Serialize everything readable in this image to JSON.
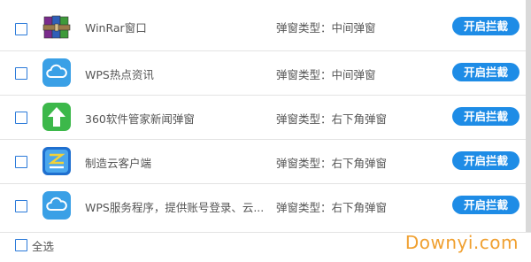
{
  "items": [
    {
      "name": "WinRar窗口",
      "type": "弹窗类型：中间弹窗",
      "button": "开启拦截",
      "icon": "winrar-books-icon"
    },
    {
      "name": "WPS热点资讯",
      "type": "弹窗类型：中间弹窗",
      "button": "开启拦截",
      "icon": "cloud-icon"
    },
    {
      "name": "360软件管家新闻弹窗",
      "type": "弹窗类型：右下角弹窗",
      "button": "开启拦截",
      "icon": "green-up-arrow-icon"
    },
    {
      "name": "制造云客户端",
      "type": "弹窗类型：右下角弹窗",
      "button": "开启拦截",
      "icon": "blue-z-logo-icon"
    },
    {
      "name": "WPS服务程序，提供账号登录、云...",
      "type": "弹窗类型：右下角弹窗",
      "button": "开启拦截",
      "icon": "cloud-icon"
    }
  ],
  "footer": {
    "select_all": "全选"
  },
  "watermark": "Downyi.com",
  "colors": {
    "accent": "#1e8ce6",
    "checkbox_border": "#2b7ad9",
    "watermark": "#f0a030"
  }
}
